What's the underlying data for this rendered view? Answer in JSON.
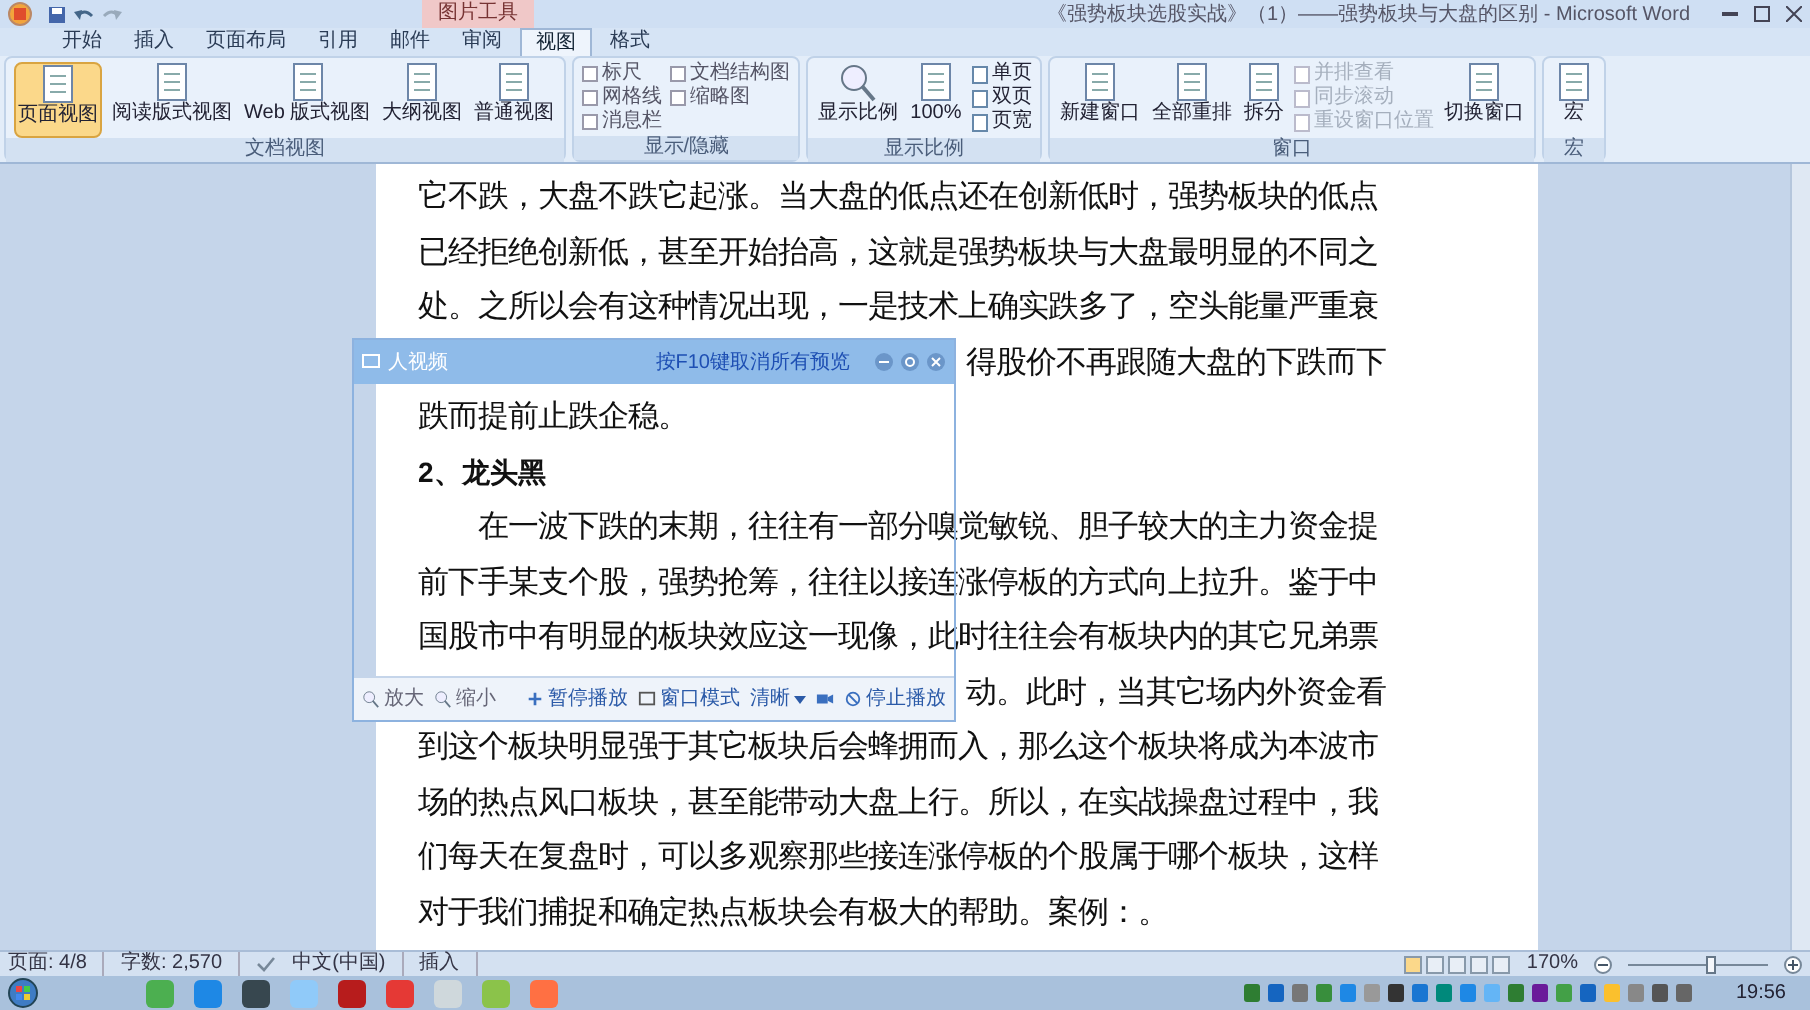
{
  "window": {
    "title": "《强势板块选股实战》（1）——强势板块与大盘的区别 - Microsoft Word",
    "context_tab": "图片工具"
  },
  "ribbon": {
    "tabs": [
      {
        "label": "开始",
        "selected": false
      },
      {
        "label": "插入",
        "selected": false
      },
      {
        "label": "页面布局",
        "selected": false
      },
      {
        "label": "引用",
        "selected": false
      },
      {
        "label": "邮件",
        "selected": false
      },
      {
        "label": "审阅",
        "selected": false
      },
      {
        "label": "视图",
        "selected": true
      },
      {
        "label": "格式",
        "selected": false
      }
    ],
    "groups": [
      {
        "label": "文档视图",
        "items": [
          {
            "kind": "large",
            "label": "页面视图",
            "selected": true
          },
          {
            "kind": "large",
            "label": "阅读版式视图",
            "selected": false
          },
          {
            "kind": "large",
            "label": "Web 版式视图",
            "selected": false
          },
          {
            "kind": "large",
            "label": "大纲视图",
            "selected": false
          },
          {
            "kind": "large",
            "label": "普通视图",
            "selected": false
          }
        ]
      },
      {
        "label": "显示/隐藏",
        "items": [
          {
            "kind": "check",
            "label": "标尺",
            "checked": false
          },
          {
            "kind": "check",
            "label": "网格线",
            "checked": false
          },
          {
            "kind": "check",
            "label": "消息栏",
            "checked": false
          },
          {
            "kind": "check",
            "label": "文档结构图",
            "checked": false
          },
          {
            "kind": "check",
            "label": "缩略图",
            "checked": false
          }
        ]
      },
      {
        "label": "显示比例",
        "items": [
          {
            "kind": "magnifier",
            "label": "显示比例"
          },
          {
            "kind": "large",
            "label": "100%",
            "selected": false
          },
          {
            "kind": "small",
            "label": "单页",
            "disabled": false
          },
          {
            "kind": "small",
            "label": "双页",
            "disabled": false
          },
          {
            "kind": "small",
            "label": "页宽",
            "disabled": false
          }
        ]
      },
      {
        "label": "窗口",
        "items": [
          {
            "kind": "large",
            "label": "新建窗口",
            "selected": false
          },
          {
            "kind": "large",
            "label": "全部重排",
            "selected": false
          },
          {
            "kind": "large",
            "label": "拆分",
            "selected": false
          },
          {
            "kind": "small",
            "label": "并排查看",
            "disabled": true
          },
          {
            "kind": "small",
            "label": "同步滚动",
            "disabled": true
          },
          {
            "kind": "small",
            "label": "重设窗口位置",
            "disabled": true
          },
          {
            "kind": "large",
            "label": "切换窗口",
            "selected": false
          }
        ]
      },
      {
        "label": "宏",
        "items": [
          {
            "kind": "large",
            "label": "宏",
            "selected": false
          }
        ]
      }
    ]
  },
  "document": {
    "lines": [
      {
        "kind": "body",
        "text": "它不跌，大盘不跌它起涨。当大盘的低点还在创新低时，强势板块的低点"
      },
      {
        "kind": "body",
        "text": "已经拒绝创新低，甚至开始抬高，这就是强势板块与大盘最明显的不同之"
      },
      {
        "kind": "body",
        "text": "处。之所以会有这种情况出现，一是技术上确实跌多了，空头能量严重衰"
      },
      {
        "kind": "right",
        "text": "得股价不再跟随大盘的下跌而下"
      },
      {
        "kind": "body",
        "text": "跌而提前止跌企稳。"
      },
      {
        "kind": "heading",
        "text": "2、龙头黑"
      },
      {
        "kind": "body",
        "text": "　　在一波下跌的末期，往往有一部分嗅觉敏锐、胆子较大的主力资金提"
      },
      {
        "kind": "body",
        "text": "前下手某支个股，强势抢筹，往往以接连涨停板的方式向上拉升。鉴于中"
      },
      {
        "kind": "body",
        "text": "国股市中有明显的板块效应这一现像，此时往往会有板块内的其它兄弟票"
      },
      {
        "kind": "right",
        "text": "动。此时，当其它场内外资金看"
      },
      {
        "kind": "body",
        "text": "到这个板块明显强于其它板块后会蜂拥而入，那么这个板块将成为本波市"
      },
      {
        "kind": "body",
        "text": "场的热点风口板块，甚至能带动大盘上行。所以，在实战操盘过程中，我"
      },
      {
        "kind": "body",
        "text": "们每天在复盘时，可以多观察那些接连涨停板的个股属于哪个板块，这样"
      },
      {
        "kind": "body",
        "text": "对于我们捕捉和确定热点板块会有极大的帮助。案例：。"
      }
    ]
  },
  "popup": {
    "title": "人视频",
    "notice": "按F10键取消所有预览",
    "toolbar": [
      {
        "kind": "zoom-in",
        "label": "放大"
      },
      {
        "kind": "zoom-out",
        "label": "缩小"
      },
      {
        "kind": "plus",
        "label": "暂停播放"
      },
      {
        "kind": "window",
        "label": "窗口模式"
      },
      {
        "kind": "menu",
        "label": "清晰"
      },
      {
        "kind": "camera"
      },
      {
        "kind": "stop",
        "label": "停止播放"
      }
    ]
  },
  "status_bar": {
    "items": [
      "页面: 4/8",
      "字数: 2,570",
      "中文(中国)",
      "插入"
    ],
    "zoom": "170%",
    "zoom_slider": {
      "level": 0.58
    }
  },
  "taskbar": {
    "time": "19:56"
  }
}
